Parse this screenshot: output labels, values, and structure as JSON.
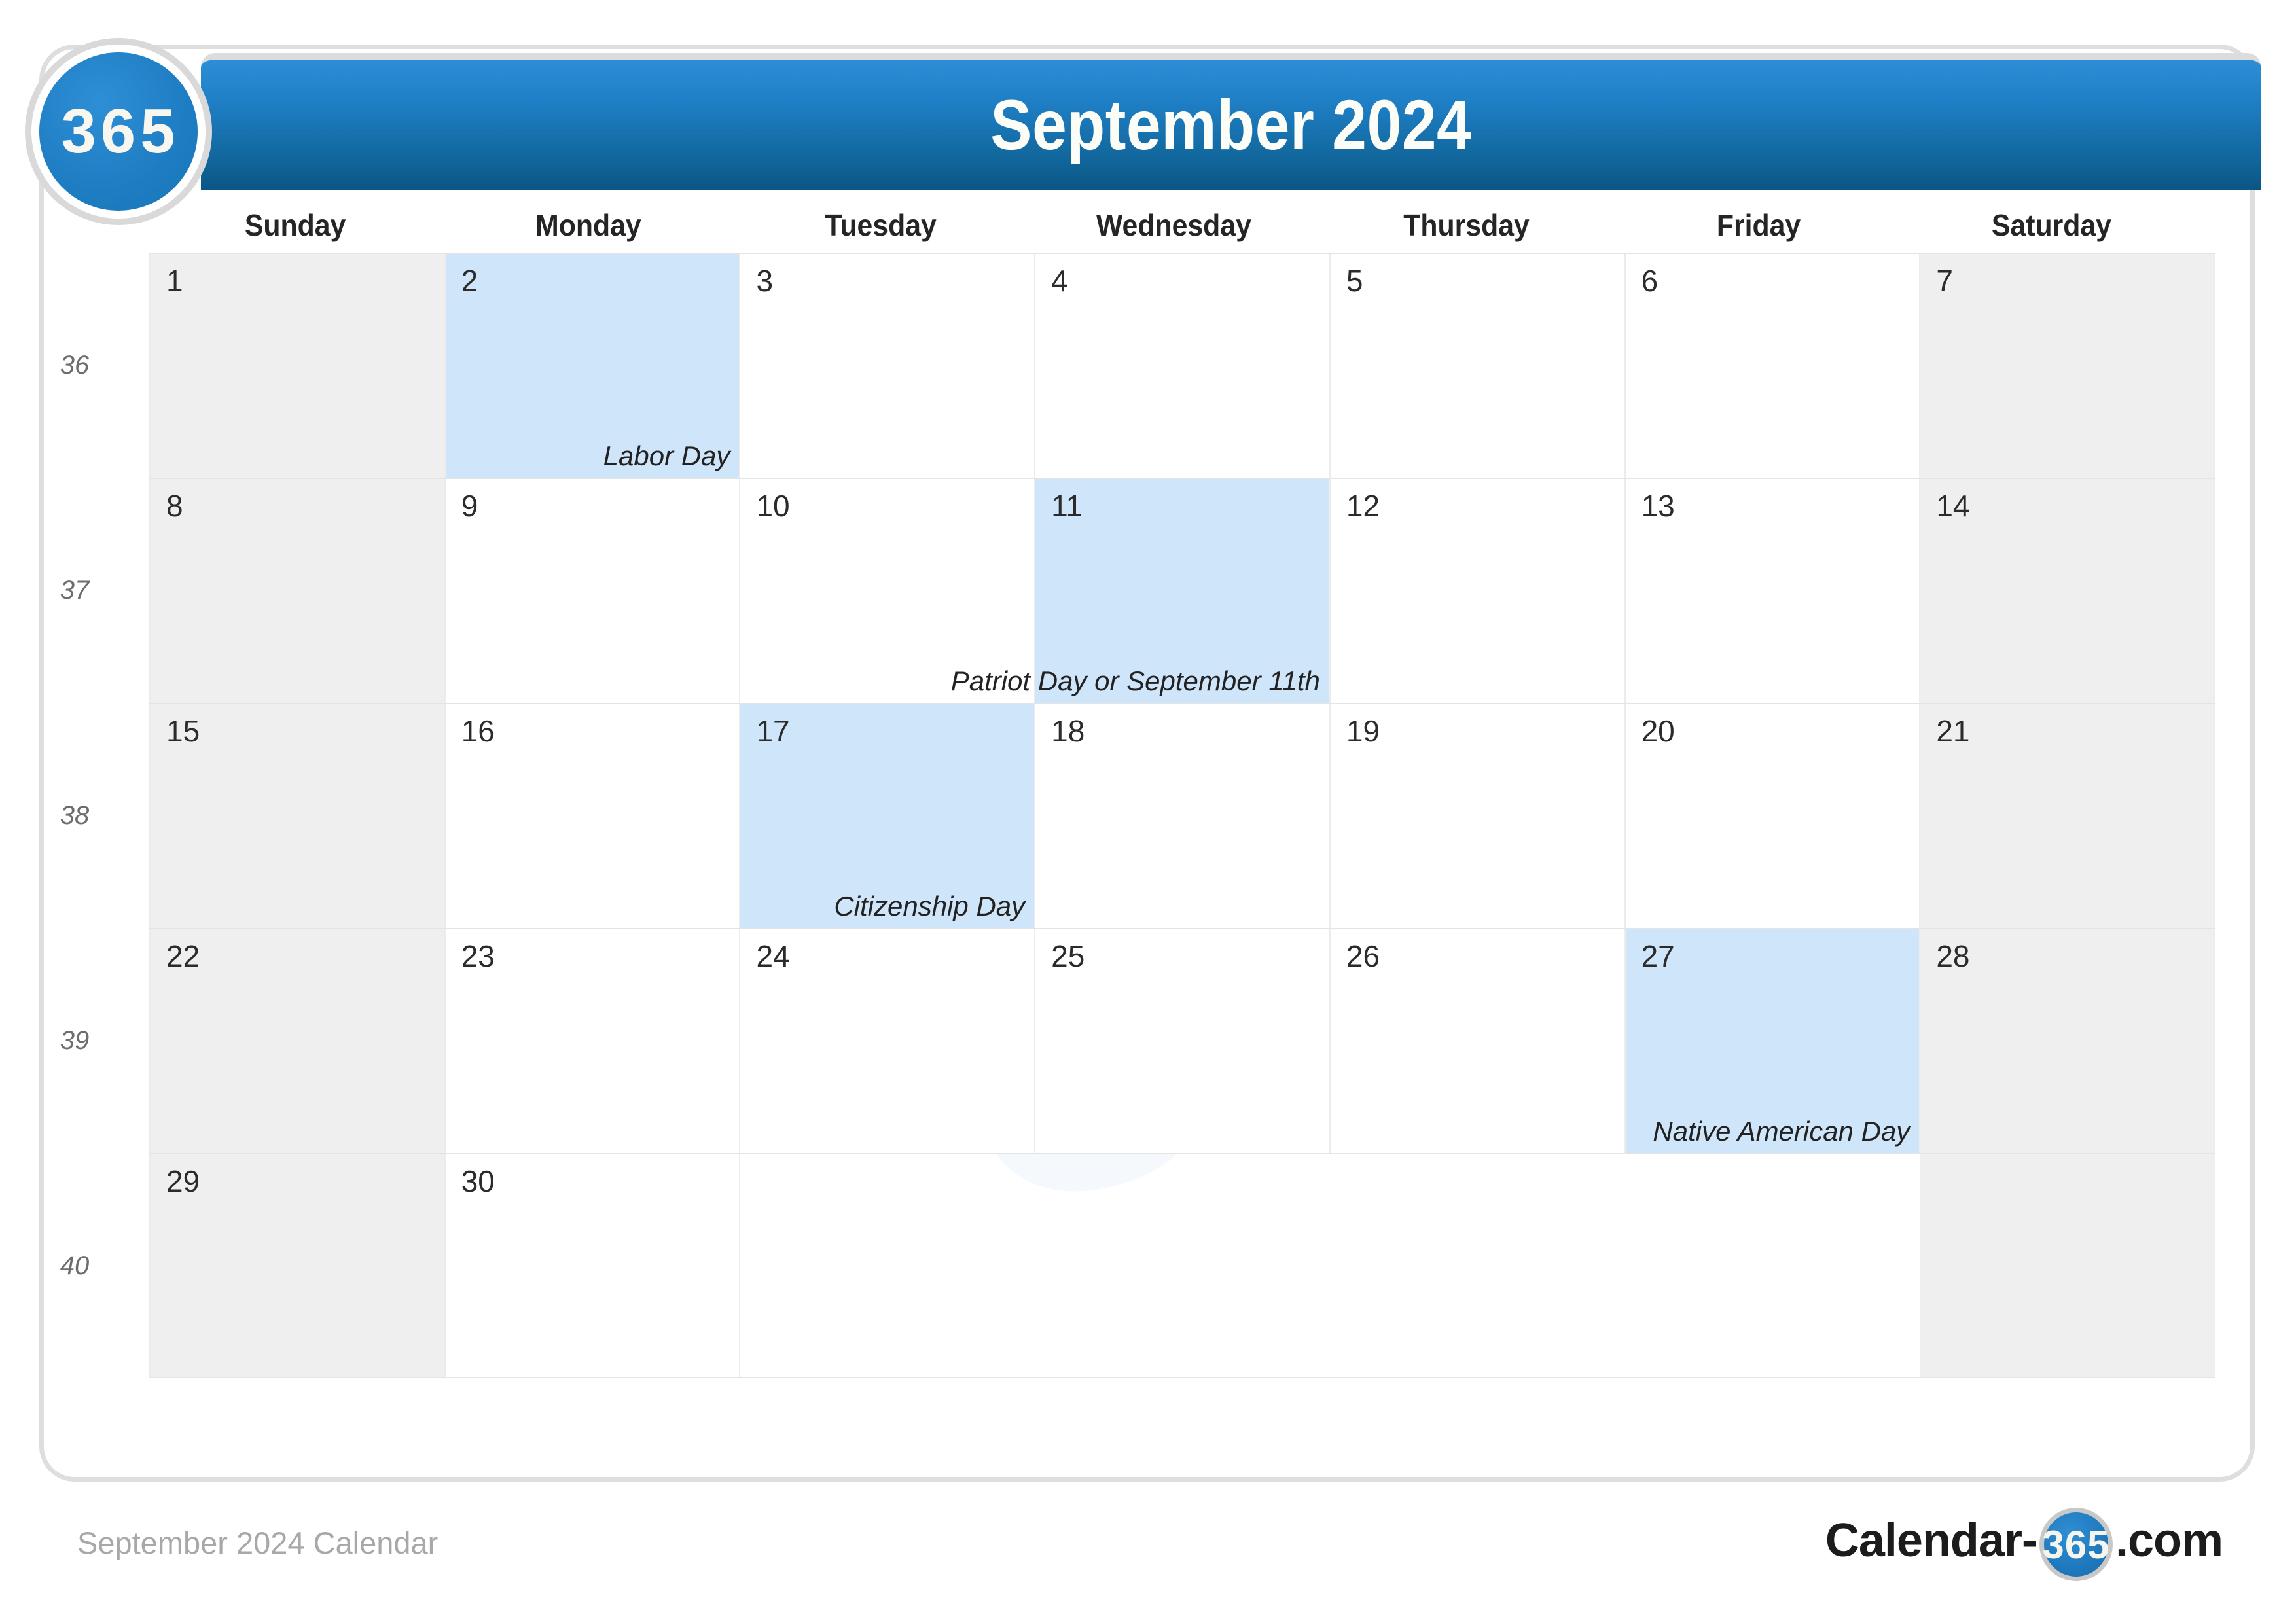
{
  "brand": {
    "badge_text": "365",
    "accent_blue": "#1f7fc6",
    "header_gradient_top": "#2d8dd6",
    "header_gradient_bottom": "#0a5685",
    "holiday_fill": "#cfe5f9",
    "weekend_fill": "#efefef"
  },
  "header": {
    "title": "September 2024"
  },
  "calendar": {
    "weekday_headers": [
      "Sunday",
      "Monday",
      "Tuesday",
      "Wednesday",
      "Thursday",
      "Friday",
      "Saturday"
    ],
    "weeks": [
      {
        "week_number": "36",
        "days": [
          {
            "day": "1",
            "weekend": true,
            "holiday": null
          },
          {
            "day": "2",
            "weekend": false,
            "holiday": "Labor Day"
          },
          {
            "day": "3",
            "weekend": false,
            "holiday": null
          },
          {
            "day": "4",
            "weekend": false,
            "holiday": null
          },
          {
            "day": "5",
            "weekend": false,
            "holiday": null
          },
          {
            "day": "6",
            "weekend": false,
            "holiday": null
          },
          {
            "day": "7",
            "weekend": true,
            "holiday": null
          }
        ]
      },
      {
        "week_number": "37",
        "days": [
          {
            "day": "8",
            "weekend": true,
            "holiday": null
          },
          {
            "day": "9",
            "weekend": false,
            "holiday": null
          },
          {
            "day": "10",
            "weekend": false,
            "holiday": null
          },
          {
            "day": "11",
            "weekend": false,
            "holiday": "Patriot Day or September 11th"
          },
          {
            "day": "12",
            "weekend": false,
            "holiday": null
          },
          {
            "day": "13",
            "weekend": false,
            "holiday": null
          },
          {
            "day": "14",
            "weekend": true,
            "holiday": null
          }
        ]
      },
      {
        "week_number": "38",
        "days": [
          {
            "day": "15",
            "weekend": true,
            "holiday": null
          },
          {
            "day": "16",
            "weekend": false,
            "holiday": null
          },
          {
            "day": "17",
            "weekend": false,
            "holiday": "Citizenship Day"
          },
          {
            "day": "18",
            "weekend": false,
            "holiday": null
          },
          {
            "day": "19",
            "weekend": false,
            "holiday": null
          },
          {
            "day": "20",
            "weekend": false,
            "holiday": null
          },
          {
            "day": "21",
            "weekend": true,
            "holiday": null
          }
        ]
      },
      {
        "week_number": "39",
        "days": [
          {
            "day": "22",
            "weekend": true,
            "holiday": null
          },
          {
            "day": "23",
            "weekend": false,
            "holiday": null
          },
          {
            "day": "24",
            "weekend": false,
            "holiday": null
          },
          {
            "day": "25",
            "weekend": false,
            "holiday": null
          },
          {
            "day": "26",
            "weekend": false,
            "holiday": null
          },
          {
            "day": "27",
            "weekend": false,
            "holiday": "Native American Day"
          },
          {
            "day": "28",
            "weekend": true,
            "holiday": null
          }
        ]
      },
      {
        "week_number": "40",
        "days": [
          {
            "day": "29",
            "weekend": true,
            "holiday": null
          },
          {
            "day": "30",
            "weekend": false,
            "holiday": null
          },
          {
            "day": "",
            "weekend": false,
            "holiday": null,
            "empty": true
          },
          {
            "day": "",
            "weekend": false,
            "holiday": null,
            "empty": true
          },
          {
            "day": "",
            "weekend": false,
            "holiday": null,
            "empty": true
          },
          {
            "day": "",
            "weekend": false,
            "holiday": null,
            "empty": true
          },
          {
            "day": "",
            "weekend": true,
            "holiday": null,
            "empty": true
          }
        ]
      }
    ]
  },
  "footer": {
    "caption": "September 2024 Calendar",
    "logo_prefix": "Calendar-",
    "logo_badge": "365",
    "logo_suffix": ".com"
  }
}
